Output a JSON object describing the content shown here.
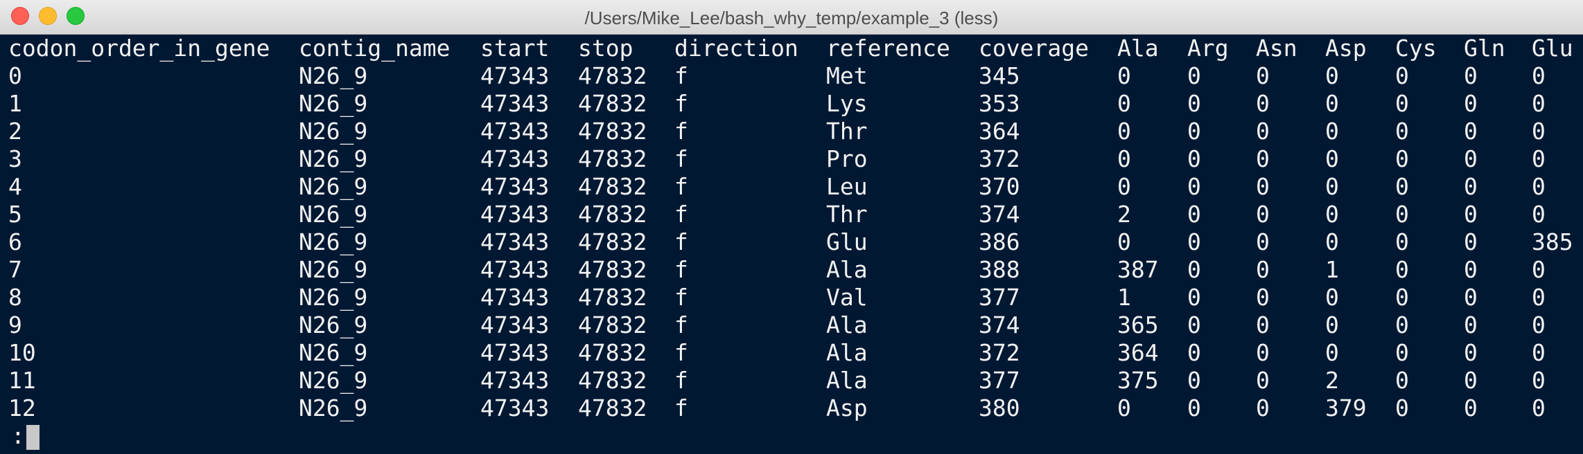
{
  "window": {
    "title": "/Users/Mike_Lee/bash_why_temp/example_3 (less)"
  },
  "table": {
    "headers": [
      "codon_order_in_gene",
      "contig_name",
      "start",
      "stop",
      "direction",
      "reference",
      "coverage",
      "Ala",
      "Arg",
      "Asn",
      "Asp",
      "Cys",
      "Gln",
      "Glu"
    ],
    "rows": [
      [
        "0",
        "N26_9",
        "47343",
        "47832",
        "f",
        "Met",
        "345",
        "0",
        "0",
        "0",
        "0",
        "0",
        "0",
        "0"
      ],
      [
        "1",
        "N26_9",
        "47343",
        "47832",
        "f",
        "Lys",
        "353",
        "0",
        "0",
        "0",
        "0",
        "0",
        "0",
        "0"
      ],
      [
        "2",
        "N26_9",
        "47343",
        "47832",
        "f",
        "Thr",
        "364",
        "0",
        "0",
        "0",
        "0",
        "0",
        "0",
        "0"
      ],
      [
        "3",
        "N26_9",
        "47343",
        "47832",
        "f",
        "Pro",
        "372",
        "0",
        "0",
        "0",
        "0",
        "0",
        "0",
        "0"
      ],
      [
        "4",
        "N26_9",
        "47343",
        "47832",
        "f",
        "Leu",
        "370",
        "0",
        "0",
        "0",
        "0",
        "0",
        "0",
        "0"
      ],
      [
        "5",
        "N26_9",
        "47343",
        "47832",
        "f",
        "Thr",
        "374",
        "2",
        "0",
        "0",
        "0",
        "0",
        "0",
        "0"
      ],
      [
        "6",
        "N26_9",
        "47343",
        "47832",
        "f",
        "Glu",
        "386",
        "0",
        "0",
        "0",
        "0",
        "0",
        "0",
        "385"
      ],
      [
        "7",
        "N26_9",
        "47343",
        "47832",
        "f",
        "Ala",
        "388",
        "387",
        "0",
        "0",
        "1",
        "0",
        "0",
        "0"
      ],
      [
        "8",
        "N26_9",
        "47343",
        "47832",
        "f",
        "Val",
        "377",
        "1",
        "0",
        "0",
        "0",
        "0",
        "0",
        "0"
      ],
      [
        "9",
        "N26_9",
        "47343",
        "47832",
        "f",
        "Ala",
        "374",
        "365",
        "0",
        "0",
        "0",
        "0",
        "0",
        "0"
      ],
      [
        "10",
        "N26_9",
        "47343",
        "47832",
        "f",
        "Ala",
        "372",
        "364",
        "0",
        "0",
        "0",
        "0",
        "0",
        "0"
      ],
      [
        "11",
        "N26_9",
        "47343",
        "47832",
        "f",
        "Ala",
        "377",
        "375",
        "0",
        "0",
        "2",
        "0",
        "0",
        "0"
      ],
      [
        "12",
        "N26_9",
        "47343",
        "47832",
        "f",
        "Asp",
        "380",
        "0",
        "0",
        "0",
        "379",
        "0",
        "0",
        "0"
      ]
    ]
  },
  "prompt": {
    "text": ":"
  },
  "colors": {
    "terminal_background": "#011833",
    "terminal_text": "#f2f2f2"
  }
}
